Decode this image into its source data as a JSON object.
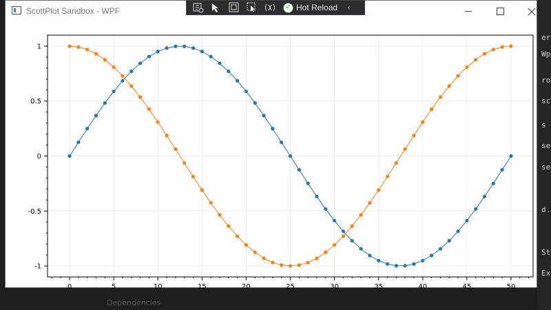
{
  "window": {
    "title": "ScottPlot Sandbox - WPF"
  },
  "debug_toolbar": {
    "hot_reload_label": "Hot Reload"
  },
  "background": {
    "ide_fragments": [
      "er",
      "Wp",
      "ro",
      "sc",
      "s",
      "se",
      "se",
      "d.",
      "St",
      "Ex"
    ],
    "bottom_text": "Dependencies"
  },
  "colors": {
    "series_sin": "#1f77b4",
    "series_cos": "#ff7f0e",
    "grid": "#ebebeb"
  },
  "chart_data": {
    "type": "scatter",
    "title": "",
    "xlabel": "",
    "ylabel": "",
    "xlim": [
      -2.5,
      52.5
    ],
    "ylim": [
      -1.1,
      1.1
    ],
    "xticks": [
      "0",
      "5",
      "10",
      "15",
      "20",
      "25",
      "30",
      "35",
      "40",
      "45",
      "50"
    ],
    "yticks": [
      "1",
      "0.5",
      "0",
      "-0.5",
      "-1"
    ],
    "grid": true,
    "x": [
      0,
      1,
      2,
      3,
      4,
      5,
      6,
      7,
      8,
      9,
      10,
      11,
      12,
      13,
      14,
      15,
      16,
      17,
      18,
      19,
      20,
      21,
      22,
      23,
      24,
      25,
      26,
      27,
      28,
      29,
      30,
      31,
      32,
      33,
      34,
      35,
      36,
      37,
      38,
      39,
      40,
      41,
      42,
      43,
      44,
      45,
      46,
      47,
      48,
      49,
      50
    ],
    "series": [
      {
        "values": [
          0,
          0.125,
          0.249,
          0.368,
          0.482,
          0.588,
          0.685,
          0.771,
          0.844,
          0.905,
          0.951,
          0.982,
          0.998,
          0.998,
          0.982,
          0.951,
          0.905,
          0.844,
          0.771,
          0.685,
          0.588,
          0.482,
          0.368,
          0.249,
          0.125,
          0,
          -0.125,
          -0.249,
          -0.368,
          -0.482,
          -0.588,
          -0.685,
          -0.771,
          -0.844,
          -0.905,
          -0.951,
          -0.982,
          -0.998,
          -0.998,
          -0.982,
          -0.951,
          -0.905,
          -0.844,
          -0.771,
          -0.685,
          -0.588,
          -0.482,
          -0.368,
          -0.249,
          -0.125,
          0
        ]
      },
      {
        "values": [
          1,
          0.992,
          0.969,
          0.93,
          0.876,
          0.809,
          0.729,
          0.637,
          0.536,
          0.426,
          0.309,
          0.187,
          0.063,
          -0.063,
          -0.187,
          -0.309,
          -0.426,
          -0.536,
          -0.637,
          -0.729,
          -0.809,
          -0.876,
          -0.93,
          -0.969,
          -0.992,
          -1,
          -0.992,
          -0.969,
          -0.93,
          -0.876,
          -0.809,
          -0.729,
          -0.637,
          -0.536,
          -0.426,
          -0.309,
          -0.187,
          -0.063,
          0.063,
          0.187,
          0.309,
          0.426,
          0.536,
          0.637,
          0.729,
          0.809,
          0.876,
          0.93,
          0.969,
          0.992,
          1
        ]
      }
    ]
  }
}
